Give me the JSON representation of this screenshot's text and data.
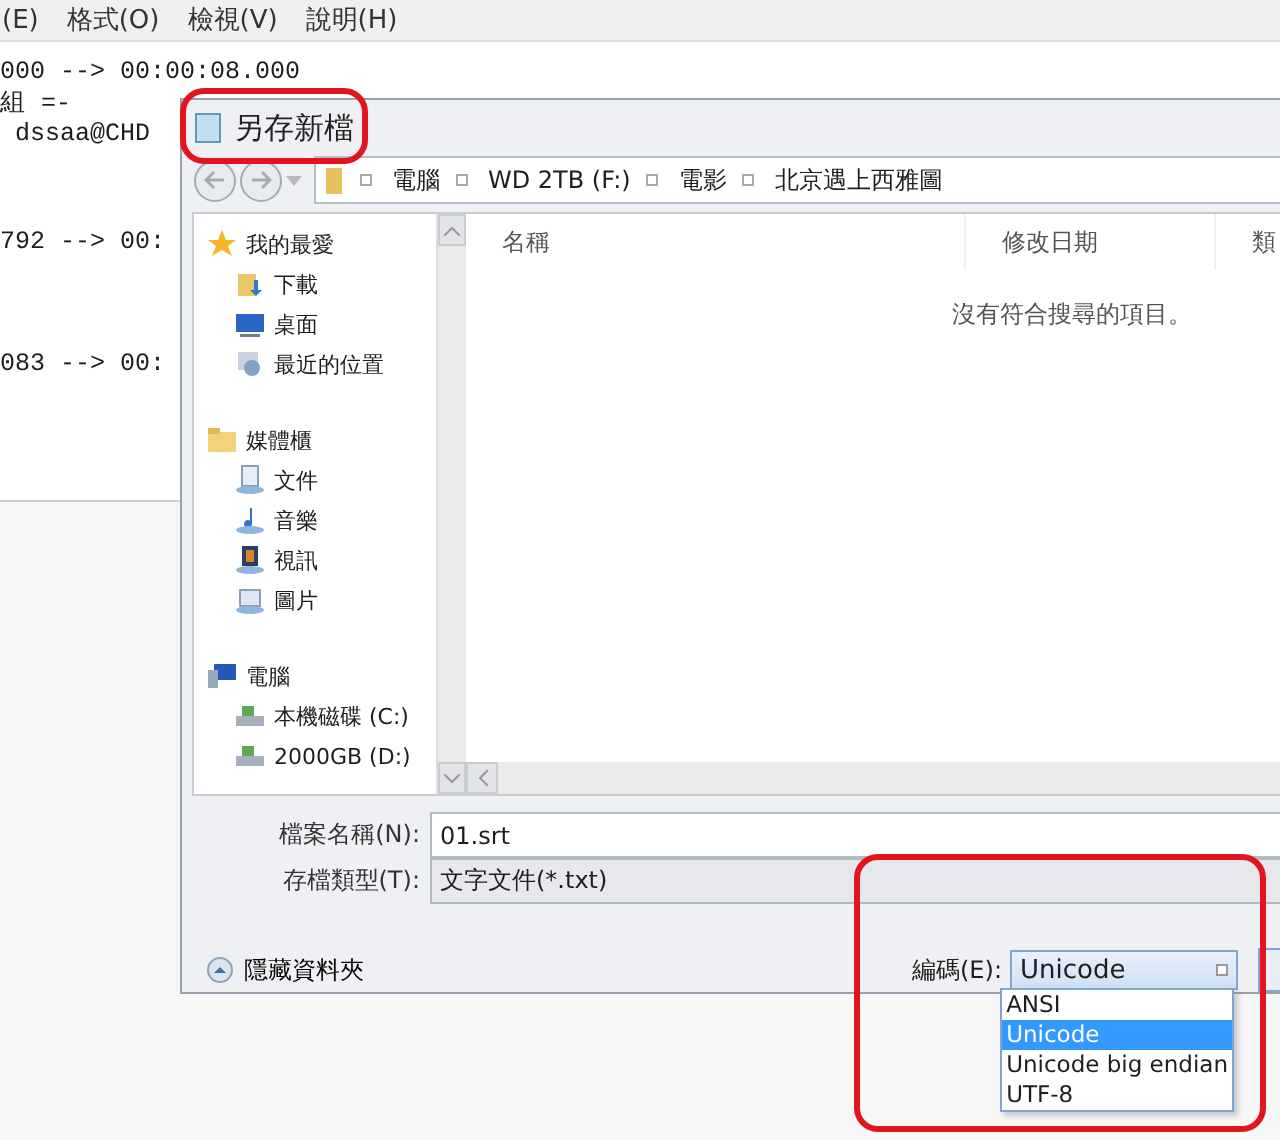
{
  "notepad": {
    "menu": [
      "(E)",
      "格式(O)",
      "檢視(V)",
      "說明(H)"
    ],
    "blocks": [
      [
        "000 --> 00:00:08.000",
        "組 =-",
        " dssaa@CHD"
      ],
      [
        "792 --> 00:"
      ],
      [
        "083 --> 00:"
      ]
    ]
  },
  "dialog": {
    "title": "另存新檔",
    "breadcrumbs": [
      "電腦",
      "WD 2TB (F:)",
      "電影",
      "北京遇上西雅圖"
    ],
    "nav_groups": [
      {
        "label": "我的最愛",
        "kind": "star",
        "items": [
          {
            "label": "下載",
            "kind": "downloads"
          },
          {
            "label": "桌面",
            "kind": "desktop"
          },
          {
            "label": "最近的位置",
            "kind": "recent"
          }
        ]
      },
      {
        "label": "媒體櫃",
        "kind": "library",
        "items": [
          {
            "label": "文件",
            "kind": "documents"
          },
          {
            "label": "音樂",
            "kind": "music"
          },
          {
            "label": "視訊",
            "kind": "video"
          },
          {
            "label": "圖片",
            "kind": "pictures"
          }
        ]
      },
      {
        "label": "電腦",
        "kind": "computer",
        "items": [
          {
            "label": "本機磁碟 (C:)",
            "kind": "drive"
          },
          {
            "label": "2000GB (D:)",
            "kind": "drive"
          }
        ]
      }
    ],
    "columns": [
      "名稱",
      "修改日期",
      "類"
    ],
    "empty_message": "沒有符合搜尋的項目。",
    "file_name": {
      "label": "檔案名稱(N):",
      "value": "01.srt"
    },
    "file_type": {
      "label": "存檔類型(T):",
      "value": "文字文件(*.txt)"
    },
    "hide_folders": "隱藏資料夾",
    "encoding": {
      "label": "編碼(E):",
      "value": "Unicode",
      "options": [
        {
          "label": "ANSI",
          "selected": false
        },
        {
          "label": "Unicode",
          "selected": true
        },
        {
          "label": "Unicode big endian",
          "selected": false
        },
        {
          "label": "UTF-8",
          "selected": false
        }
      ]
    }
  }
}
